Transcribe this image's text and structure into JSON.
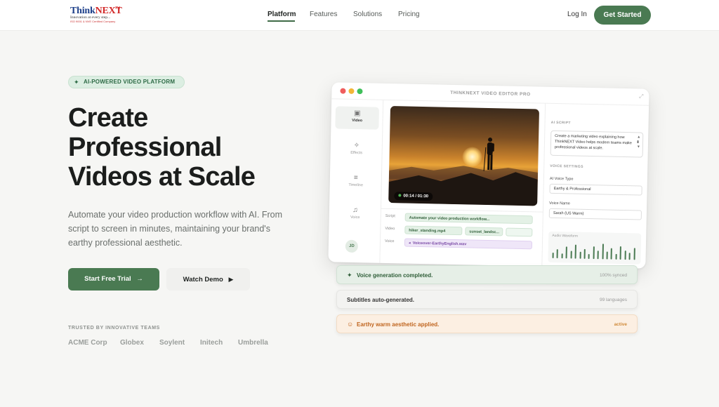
{
  "logo": {
    "main_a": "Think",
    "main_b": "NEXT",
    "sup": "TM",
    "tagline": "Innovation at every step...",
    "tagline2": "ISO 9001 & NVE Certified Company"
  },
  "nav": {
    "links": [
      "Platform",
      "Features",
      "Solutions",
      "Pricing"
    ],
    "active": "Platform",
    "login": "Log In",
    "cta": "Get Started"
  },
  "hero": {
    "badge": "AI-POWERED VIDEO PLATFORM",
    "headline_1": "Create",
    "headline_2": "Professional",
    "headline_3": "Videos at Scale",
    "subtext": "Automate your video production workflow with AI. From script to screen in minutes, maintaining your brand's earthy professional aesthetic.",
    "primary_cta": "Start Free Trial",
    "secondary_cta": "Watch Demo",
    "trusted_label": "TRUSTED BY INNOVATIVE TEAMS",
    "brands": [
      "ACME Corp",
      "Globex",
      "Soylent",
      "Initech",
      "Umbrella"
    ]
  },
  "editor": {
    "title": "THINKNEXT VIDEO EDITOR PRO",
    "sidebar": [
      {
        "label": "Video",
        "icon": "film-icon"
      },
      {
        "label": "Effects",
        "icon": "sparkle-icon"
      },
      {
        "label": "Timeline",
        "icon": "timeline-icon"
      },
      {
        "label": "Voice",
        "icon": "mic-icon"
      }
    ],
    "avatar": "JD",
    "time": "00:14 / 01:30",
    "tracks": {
      "script_label": "Script",
      "video_label": "Video",
      "voice_label": "Voice",
      "script_clip": "Automate your video production workflow...",
      "video_clip_1": "hiker_standing.mp4",
      "video_clip_2": "sunset_landsc...",
      "voice_clip": "Voiceover-EarthyEnglish.wav"
    },
    "panel": {
      "ai_script_heading": "AI SCRIPT",
      "script_text": "Create a marketing video explaining how ThinkNEXT Video helps modern teams make professional videos at scale.",
      "voice_settings_heading": "VOICE SETTINGS",
      "voice_type_label": "AI Voice Type",
      "voice_type_value": "Earthy & Professional",
      "voice_name_label": "Voice Name",
      "voice_name_value": "Sarah (US Warm)",
      "waveform_label": "Audio Waveform",
      "waveform_levels": [
        0.35,
        0.55,
        0.3,
        0.7,
        0.45,
        0.85,
        0.4,
        0.6,
        0.3,
        0.75,
        0.5,
        0.9,
        0.45,
        0.65,
        0.35,
        0.8,
        0.55,
        0.4,
        0.7
      ]
    }
  },
  "status_cards": [
    {
      "message": "Voice generation completed.",
      "meta": "100% synced"
    },
    {
      "message": "Subtitles auto-generated.",
      "meta": "99 languages"
    },
    {
      "message": "Earthy warm aesthetic applied.",
      "meta": "active"
    }
  ],
  "colors": {
    "accent": "#4a7a52",
    "badge_bg": "#dceee2",
    "warm": "#c0651f"
  }
}
